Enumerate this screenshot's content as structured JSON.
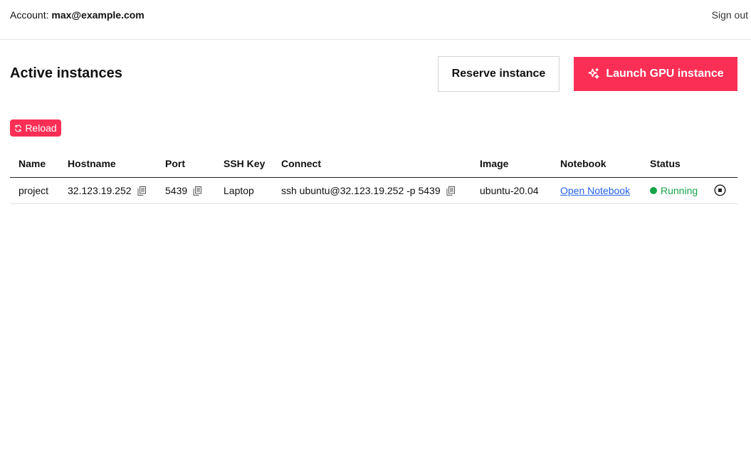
{
  "header": {
    "account_label": "Account:",
    "account_email": "max@example.com",
    "signout_label": "Sign out"
  },
  "main": {
    "title": "Active instances",
    "reserve_label": "Reserve instance",
    "launch_label": "Launch GPU instance",
    "reload_label": "Reload",
    "accent_color": "#fb2f55"
  },
  "table": {
    "columns": [
      "Name",
      "Hostname",
      "Port",
      "SSH Key",
      "Connect",
      "Image",
      "Notebook",
      "Status"
    ],
    "rows": [
      {
        "name": "project",
        "hostname": "32.123.19.252",
        "port": "5439",
        "ssh_key": "Laptop",
        "connect": "ssh ubuntu@32.123.19.252 -p 5439",
        "image": "ubuntu-20.04",
        "notebook": "Open Notebook",
        "status": "Running",
        "status_color": "#16a34a"
      }
    ]
  },
  "icons": {
    "launch": "sparkle-icon",
    "reload": "refresh-icon",
    "copy": "copy-icon",
    "stop": "stop-icon"
  }
}
